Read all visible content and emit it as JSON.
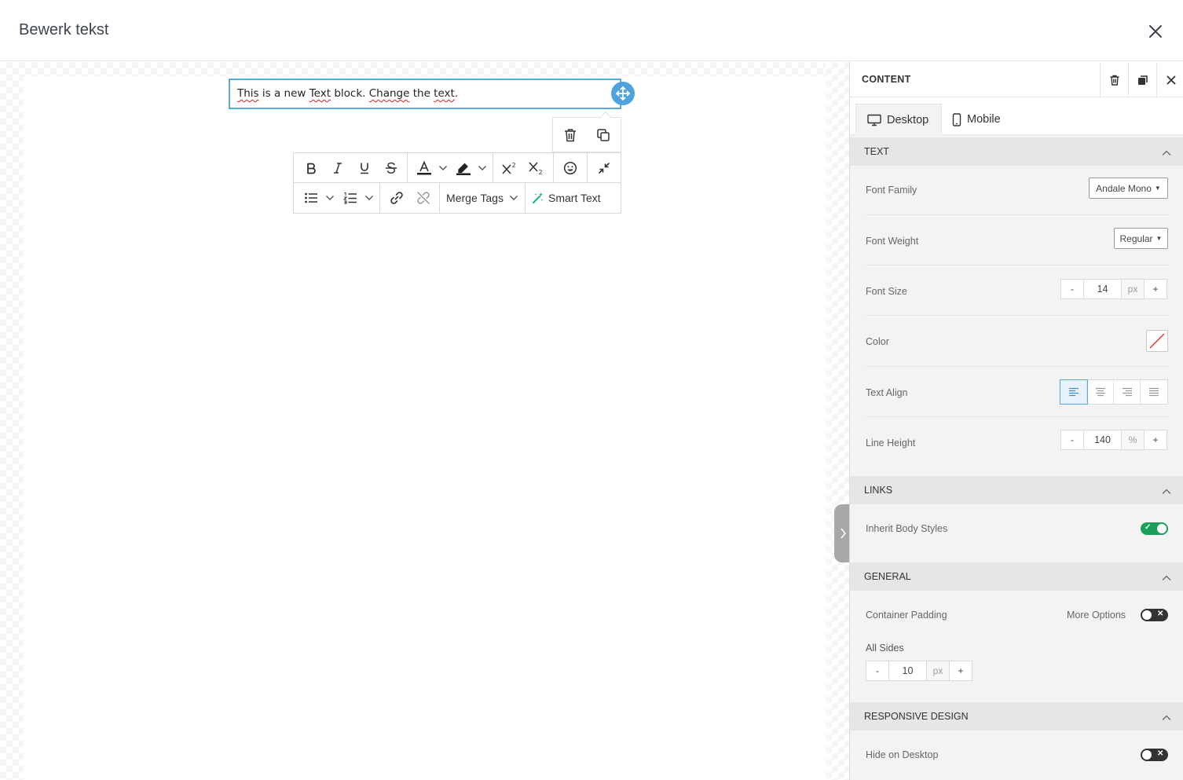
{
  "modal": {
    "title": "Bewerk tekst"
  },
  "editor": {
    "text_block": {
      "words": [
        "This",
        " is a new ",
        "Text",
        " block. ",
        "Change",
        " the ",
        "text",
        "."
      ]
    },
    "toolbar": {
      "merge_tags_label": "Merge Tags",
      "smart_text_label": "Smart Text"
    }
  },
  "panel": {
    "title": "CONTENT",
    "tabs": [
      {
        "label": "Desktop",
        "active": true
      },
      {
        "label": "Mobile",
        "active": false
      }
    ],
    "text_section": {
      "title": "TEXT",
      "font_family": {
        "label": "Font Family",
        "value": "Andale Mono"
      },
      "font_weight": {
        "label": "Font Weight",
        "value": "Regular"
      },
      "font_size": {
        "label": "Font Size",
        "value": "14",
        "unit": "px",
        "minus": "-",
        "plus": "+"
      },
      "color": {
        "label": "Color",
        "value": "none"
      },
      "text_align": {
        "label": "Text Align",
        "value": "left"
      },
      "line_height": {
        "label": "Line Height",
        "value": "140",
        "unit": "%",
        "minus": "-",
        "plus": "+"
      }
    },
    "links_section": {
      "title": "LINKS",
      "inherit_body_styles": {
        "label": "Inherit Body Styles",
        "on": true
      }
    },
    "general_section": {
      "title": "GENERAL",
      "container_padding": {
        "label": "Container Padding",
        "more_options_label": "More Options",
        "more_options_on": false
      },
      "all_sides": {
        "label": "All Sides",
        "value": "10",
        "unit": "px",
        "minus": "-",
        "plus": "+"
      }
    },
    "responsive_section": {
      "title": "RESPONSIVE DESIGN",
      "hide_on_desktop": {
        "label": "Hide on Desktop",
        "on": false
      }
    }
  },
  "colors": {
    "accent": "#4fa3dc",
    "toggle_on": "#1aa05a",
    "smart_text_icon": "#19b08a"
  }
}
